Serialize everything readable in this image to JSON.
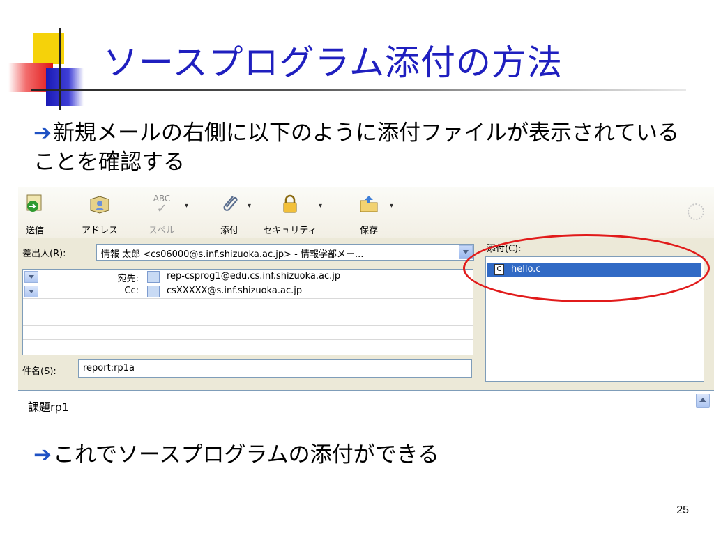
{
  "slide": {
    "title": "ソースプログラム添付の方法",
    "bullet1": "新規メールの右側に以下のように添付ファイルが表示されていることを確認する",
    "bullet2": "これでソースプログラムの添付ができる",
    "arrow": "➔",
    "page_number": "25",
    "accent_color": "#1f1fbf",
    "highlight_color": "#e11b1b"
  },
  "mail_window": {
    "toolbar": [
      {
        "label": "送信",
        "icon": "send-icon"
      },
      {
        "label": "アドレス",
        "icon": "address-book-icon"
      },
      {
        "label": "スペル",
        "icon": "spellcheck-icon",
        "icon_text": "ABC",
        "disabled": true
      },
      {
        "label": "添付",
        "icon": "paperclip-icon"
      },
      {
        "label": "セキュリティ",
        "icon": "lock-icon"
      },
      {
        "label": "保存",
        "icon": "save-folder-icon"
      }
    ],
    "from_label": "差出人(R):",
    "from_value": "情報 太郎 <cs06000@s.inf.shizuoka.ac.jp> - 情報学部メー...",
    "recipients": [
      {
        "label": "宛先:",
        "address": "rep-csprog1@edu.cs.inf.shizuoka.ac.jp"
      },
      {
        "label": "Cc:",
        "address": "csXXXXX@s.inf.shizuoka.ac.jp"
      }
    ],
    "subject_label": "件名(S):",
    "subject_value": "report:rp1a",
    "attachment_label": "添付(C):",
    "attachments": [
      {
        "name": "hello.c",
        "icon_text": "C"
      }
    ],
    "body_text": "課題rp1"
  }
}
